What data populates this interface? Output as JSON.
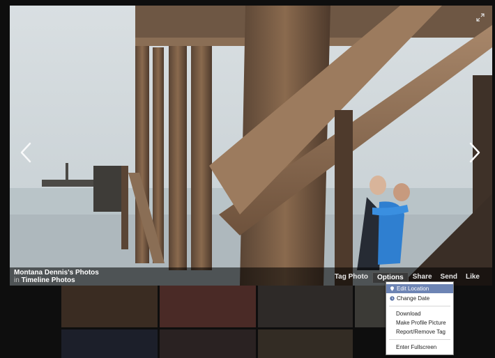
{
  "caption": {
    "owner": "Montana Dennis's Photos",
    "album_prefix": "in",
    "album": "Timeline Photos"
  },
  "actions": [
    {
      "label": "Tag Photo"
    },
    {
      "label": "Options"
    },
    {
      "label": "Share"
    },
    {
      "label": "Send"
    },
    {
      "label": "Like"
    }
  ],
  "menu": {
    "items": [
      {
        "label": "Edit Location",
        "icon": "location-pin-icon"
      },
      {
        "label": "Change Date",
        "icon": "clock-icon"
      },
      {
        "label": "Download"
      },
      {
        "label": "Make Profile Picture"
      },
      {
        "label": "Report/Remove Tag"
      },
      {
        "label": "Enter Fullscreen"
      }
    ]
  },
  "icons": {
    "previous": "chevron-left-icon",
    "next": "chevron-right-icon",
    "expand": "expand-icon"
  },
  "colors": {
    "menu_highlight": "#6d84b4",
    "background": "#0e0e0e"
  }
}
